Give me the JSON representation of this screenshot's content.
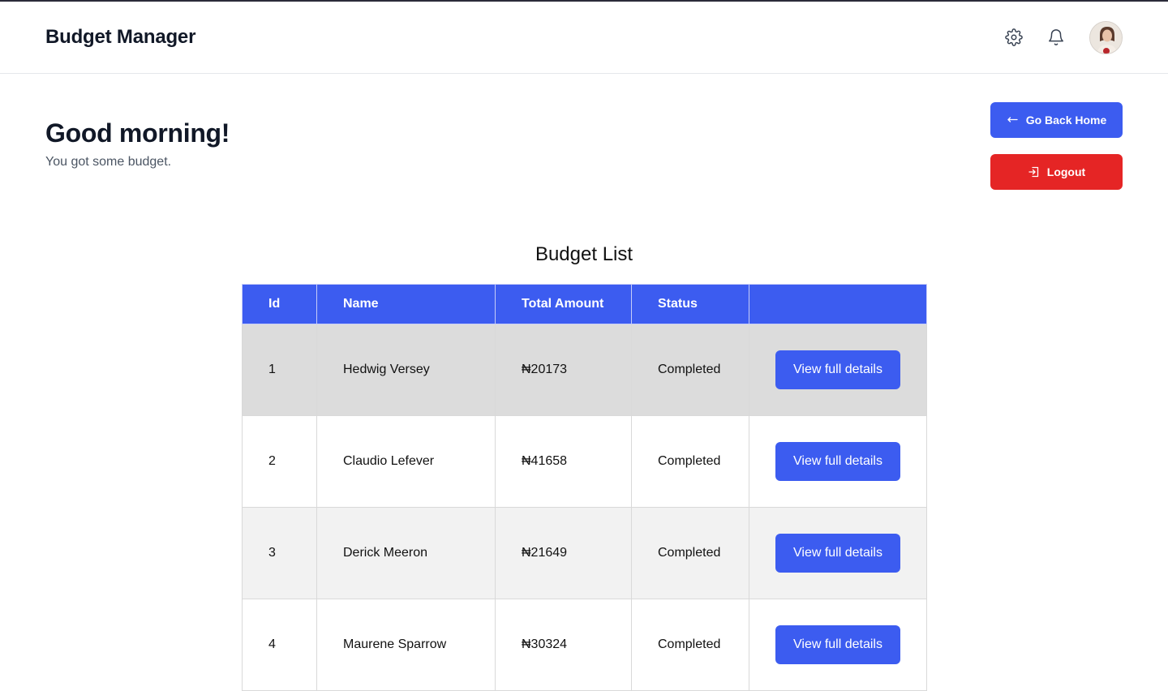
{
  "header": {
    "brand": "Budget Manager",
    "icons": [
      "gear-icon",
      "bell-icon"
    ]
  },
  "main": {
    "greeting": "Good morning!",
    "subtitle": "You got some budget.",
    "go_back_label": "Go Back Home",
    "logout_label": "Logout"
  },
  "table": {
    "title": "Budget List",
    "columns": [
      "Id",
      "Name",
      "Total Amount",
      "Status",
      ""
    ],
    "rows": [
      {
        "id": "1",
        "name": "Hedwig Versey",
        "amount": "₦20173",
        "status": "Completed",
        "action": "View full details"
      },
      {
        "id": "2",
        "name": "Claudio Lefever",
        "amount": "₦41658",
        "status": "Completed",
        "action": "View full details"
      },
      {
        "id": "3",
        "name": "Derick Meeron",
        "amount": "₦21649",
        "status": "Completed",
        "action": "View full details"
      },
      {
        "id": "4",
        "name": "Maurene Sparrow",
        "amount": "₦30324",
        "status": "Completed",
        "action": "View full details"
      }
    ]
  },
  "colors": {
    "primary": "#3c5cf0",
    "danger": "#e52525",
    "row_highlight": "#dcdcdc",
    "row_alt": "#f2f2f2"
  }
}
